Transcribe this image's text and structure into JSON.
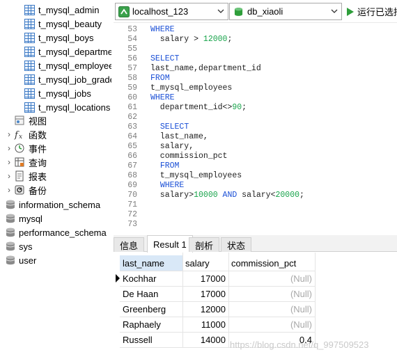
{
  "tree": {
    "tables": [
      "t_mysql_admin",
      "t_mysql_beauty",
      "t_mysql_boys",
      "t_mysql_departme",
      "t_mysql_employee",
      "t_mysql_job_grade",
      "t_mysql_jobs",
      "t_mysql_locations"
    ],
    "groups": [
      {
        "label": "视图",
        "icon": "view-icon"
      },
      {
        "label": "函数",
        "icon": "function-icon"
      },
      {
        "label": "事件",
        "icon": "event-icon"
      },
      {
        "label": "查询",
        "icon": "query-icon"
      },
      {
        "label": "报表",
        "icon": "report-icon"
      },
      {
        "label": "备份",
        "icon": "backup-icon"
      }
    ],
    "databases": [
      "information_schema",
      "mysql",
      "performance_schema",
      "sys",
      "user"
    ]
  },
  "toolbar": {
    "connection": "localhost_123",
    "database": "db_xiaoli",
    "run_label": "运行已选择"
  },
  "editor": {
    "lines": [
      {
        "n": "53",
        "tokens": [
          [
            "kw",
            "WHERE"
          ]
        ]
      },
      {
        "n": "54",
        "tokens": [
          [
            "plain",
            "  salary > "
          ],
          [
            "num",
            "12000"
          ],
          [
            "plain",
            ";"
          ]
        ]
      },
      {
        "n": "55",
        "tokens": []
      },
      {
        "n": "56",
        "tokens": [
          [
            "kw",
            "SELECT"
          ]
        ]
      },
      {
        "n": "57",
        "tokens": [
          [
            "plain",
            "last_name,department_id"
          ]
        ]
      },
      {
        "n": "58",
        "tokens": [
          [
            "kw",
            "FROM"
          ]
        ]
      },
      {
        "n": "59",
        "tokens": [
          [
            "plain",
            "t_mysql_employees"
          ]
        ]
      },
      {
        "n": "60",
        "tokens": [
          [
            "kw",
            "WHERE"
          ]
        ]
      },
      {
        "n": "61",
        "tokens": [
          [
            "plain",
            "  department_id<>"
          ],
          [
            "num",
            "90"
          ],
          [
            "plain",
            ";"
          ]
        ]
      },
      {
        "n": "62",
        "tokens": []
      },
      {
        "n": "63",
        "tokens": [
          [
            "plain",
            "  "
          ],
          [
            "kw",
            "SELECT"
          ]
        ]
      },
      {
        "n": "64",
        "tokens": [
          [
            "plain",
            "  last_name,"
          ]
        ]
      },
      {
        "n": "65",
        "tokens": [
          [
            "plain",
            "  salary,"
          ]
        ]
      },
      {
        "n": "66",
        "tokens": [
          [
            "plain",
            "  commission_pct"
          ]
        ]
      },
      {
        "n": "67",
        "tokens": [
          [
            "plain",
            "  "
          ],
          [
            "kw",
            "FROM"
          ]
        ]
      },
      {
        "n": "68",
        "tokens": [
          [
            "plain",
            "  t_mysql_employees"
          ]
        ]
      },
      {
        "n": "69",
        "tokens": [
          [
            "plain",
            "  "
          ],
          [
            "kw",
            "WHERE"
          ]
        ]
      },
      {
        "n": "70",
        "tokens": [
          [
            "plain",
            "  salary>"
          ],
          [
            "num",
            "10000"
          ],
          [
            "plain",
            " "
          ],
          [
            "kw",
            "AND"
          ],
          [
            "plain",
            " salary<"
          ],
          [
            "num",
            "20000"
          ],
          [
            "plain",
            ";"
          ]
        ]
      },
      {
        "n": "71",
        "tokens": []
      },
      {
        "n": "72",
        "tokens": []
      },
      {
        "n": "73",
        "tokens": []
      }
    ]
  },
  "result": {
    "tabs": [
      "信息",
      "Result 1",
      "剖析",
      "状态"
    ],
    "active_tab": "Result 1",
    "columns": [
      "last_name",
      "salary",
      "commission_pct"
    ],
    "rows": [
      [
        "Kochhar",
        "17000",
        "(Null)"
      ],
      [
        "De Haan",
        "17000",
        "(Null)"
      ],
      [
        "Greenberg",
        "12000",
        "(Null)"
      ],
      [
        "Raphaely",
        "11000",
        "(Null)"
      ],
      [
        "Russell",
        "14000",
        "0.4"
      ]
    ]
  },
  "watermark": "https://blog.csdn.net/q_997509523",
  "colors": {
    "keyword": "#1a4fd6",
    "number": "#17a34a",
    "selection": "#c8dcf4",
    "run_icon": "#2e9e3a"
  }
}
